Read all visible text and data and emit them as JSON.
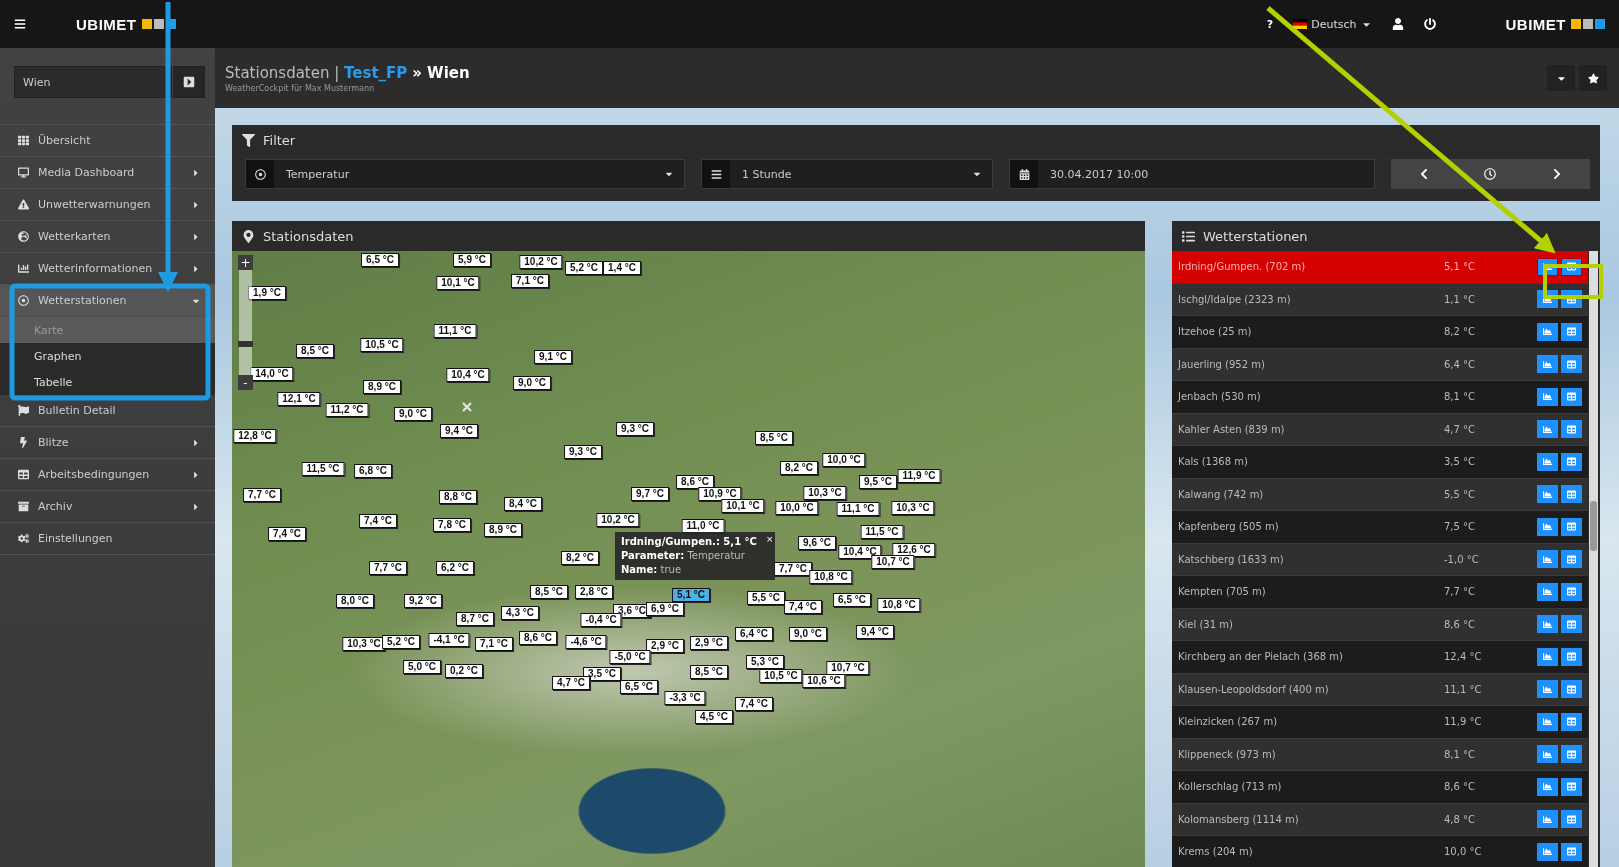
{
  "topbar": {
    "logo": "UBIMET",
    "help": "?",
    "language": "Deutsch",
    "logo_right": "UBIMET"
  },
  "sidebar": {
    "search": {
      "value": "Wien"
    },
    "items": [
      {
        "label": "Übersicht",
        "expandable": false
      },
      {
        "label": "Media Dashboard",
        "expandable": true,
        "expanded": false
      },
      {
        "label": "Unwetterwarnungen",
        "expandable": true,
        "expanded": false
      },
      {
        "label": "Wetterkarten",
        "expandable": true,
        "expanded": false
      },
      {
        "label": "Wetterinformationen",
        "expandable": true,
        "expanded": false
      },
      {
        "label": "Wetterstationen",
        "expandable": true,
        "expanded": true,
        "children": [
          {
            "label": "Karte",
            "selected": true
          },
          {
            "label": "Graphen",
            "selected": false
          },
          {
            "label": "Tabelle",
            "selected": false
          }
        ]
      },
      {
        "label": "Bulletin Detail",
        "expandable": false
      },
      {
        "label": "Blitze",
        "expandable": true,
        "expanded": false
      },
      {
        "label": "Arbeitsbedingungen",
        "expandable": true,
        "expanded": false
      },
      {
        "label": "Archiv",
        "expandable": true,
        "expanded": false
      },
      {
        "label": "Einstellungen",
        "expandable": false
      }
    ]
  },
  "page_header": {
    "title": "Stationsdaten",
    "separator": "|",
    "project": "Test_FP",
    "arrow": "»",
    "location": "Wien",
    "subtitle": "WeatherCockpit für Max Mustermann"
  },
  "filter": {
    "title": "Filter",
    "parameter": "Temperatur",
    "interval": "1 Stunde",
    "date": "30.04.2017 10:00"
  },
  "map": {
    "title": "Stationsdaten",
    "zoom_in": "+",
    "zoom_out": "-",
    "zoom_slider": {
      "level": 0.3
    },
    "markers": [
      {
        "label": "6,5 °C",
        "selected": false
      },
      {
        "label": "5,9 °C",
        "selected": false
      },
      {
        "label": "10,2 °C",
        "selected": false
      },
      {
        "label": "5,2 °C",
        "selected": false
      },
      {
        "label": "1,4 °C",
        "selected": false
      },
      {
        "label": "10,1 °C",
        "selected": false
      },
      {
        "label": "7,1 °C",
        "selected": false
      },
      {
        "label": "1,9 °C",
        "selected": false
      },
      {
        "label": "11,1 °C",
        "selected": false
      },
      {
        "label": "8,5 °C",
        "selected": false
      },
      {
        "label": "10,5 °C",
        "selected": false
      },
      {
        "label": "9,1 °C",
        "selected": false
      },
      {
        "label": "14,0 °C",
        "selected": false
      },
      {
        "label": "10,4 °C",
        "selected": false
      },
      {
        "label": "9,0 °C",
        "selected": false
      },
      {
        "label": "8,9 °C",
        "selected": false
      },
      {
        "label": "12,1 °C",
        "selected": false
      },
      {
        "label": "11,2 °C",
        "selected": false
      },
      {
        "label": "9,0 °C",
        "selected": false
      },
      {
        "label": "9,4 °C",
        "selected": false
      },
      {
        "label": "9,3 °C",
        "selected": false
      },
      {
        "label": "12,8 °C",
        "selected": false
      },
      {
        "label": "9,3 °C",
        "selected": false
      },
      {
        "label": "11,5 °C",
        "selected": false
      },
      {
        "label": "6,8 °C",
        "selected": false
      },
      {
        "label": "7,7 °C",
        "selected": false
      },
      {
        "label": "8,8 °C",
        "selected": false
      },
      {
        "label": "8,4 °C",
        "selected": false
      },
      {
        "label": "9,7 °C",
        "selected": false
      },
      {
        "label": "8,6 °C",
        "selected": false
      },
      {
        "label": "7,4 °C",
        "selected": false
      },
      {
        "label": "7,8 °C",
        "selected": false
      },
      {
        "label": "8,9 °C",
        "selected": false
      },
      {
        "label": "10,2 °C",
        "selected": false
      },
      {
        "label": "7,4 °C",
        "selected": false
      },
      {
        "label": "8,5 °C",
        "selected": false
      },
      {
        "label": "10,0 °C",
        "selected": false
      },
      {
        "label": "8,2 °C",
        "selected": false
      },
      {
        "label": "11,9 °C",
        "selected": false
      },
      {
        "label": "9,5 °C",
        "selected": false
      },
      {
        "label": "10,9 °C",
        "selected": false
      },
      {
        "label": "10,3 °C",
        "selected": false
      },
      {
        "label": "10,1 °C",
        "selected": false
      },
      {
        "label": "10,0 °C",
        "selected": false
      },
      {
        "label": "11,1 °C",
        "selected": false
      },
      {
        "label": "10,3 °C",
        "selected": false
      },
      {
        "label": "11,0 °C",
        "selected": false
      },
      {
        "label": "11,5 °C",
        "selected": false
      },
      {
        "label": "9,6 °C",
        "selected": false
      },
      {
        "label": "10,4 °C",
        "selected": false
      },
      {
        "label": "12,6 °C",
        "selected": false
      },
      {
        "label": "10,7 °C",
        "selected": false
      },
      {
        "label": "7,7 °C",
        "selected": false
      },
      {
        "label": "6,2 °C",
        "selected": false
      },
      {
        "label": "8,2 °C",
        "selected": false
      },
      {
        "label": "7,7 °C",
        "selected": false
      },
      {
        "label": "10,8 °C",
        "selected": false
      },
      {
        "label": "8,0 °C",
        "selected": false
      },
      {
        "label": "9,2 °C",
        "selected": false
      },
      {
        "label": "8,5 °C",
        "selected": false
      },
      {
        "label": "2,8 °C",
        "selected": false
      },
      {
        "label": "5,1 °C",
        "selected": true
      },
      {
        "label": "5,5 °C",
        "selected": false
      },
      {
        "label": "7,4 °C",
        "selected": false
      },
      {
        "label": "6,5 °C",
        "selected": false
      },
      {
        "label": "10,8 °C",
        "selected": false
      },
      {
        "label": "8,7 °C",
        "selected": false
      },
      {
        "label": "4,3 °C",
        "selected": false
      },
      {
        "label": "3,6 °C",
        "selected": false
      },
      {
        "label": "6,9 °C",
        "selected": false
      },
      {
        "label": "-0,4 °C",
        "selected": false
      },
      {
        "label": "10,3 °C",
        "selected": false
      },
      {
        "label": "5,2 °C",
        "selected": false
      },
      {
        "label": "-4,1 °C",
        "selected": false
      },
      {
        "label": "7,1 °C",
        "selected": false
      },
      {
        "label": "8,6 °C",
        "selected": false
      },
      {
        "label": "-4,6 °C",
        "selected": false
      },
      {
        "label": "6,4 °C",
        "selected": false
      },
      {
        "label": "9,0 °C",
        "selected": false
      },
      {
        "label": "9,4 °C",
        "selected": false
      },
      {
        "label": "2,9 °C",
        "selected": false
      },
      {
        "label": "2,9 °C",
        "selected": false
      },
      {
        "label": "-5,0 °C",
        "selected": false
      },
      {
        "label": "5,0 °C",
        "selected": false
      },
      {
        "label": "0,2 °C",
        "selected": false
      },
      {
        "label": "5,3 °C",
        "selected": false
      },
      {
        "label": "10,7 °C",
        "selected": false
      },
      {
        "label": "8,5 °C",
        "selected": false
      },
      {
        "label": "10,5 °C",
        "selected": false
      },
      {
        "label": "10,6 °C",
        "selected": false
      },
      {
        "label": "3,5 °C",
        "selected": false
      },
      {
        "label": "4,7 °C",
        "selected": false
      },
      {
        "label": "6,5 °C",
        "selected": false
      },
      {
        "label": "-3,3 °C",
        "selected": false
      },
      {
        "label": "7,4 °C",
        "selected": false
      },
      {
        "label": "4,5 °C",
        "selected": false
      }
    ],
    "popup": {
      "title": "Irdning/Gumpen.: 5,1 °C",
      "close": "×",
      "lines": [
        {
          "key": "Parameter:",
          "value": "Temperatur"
        },
        {
          "key": "Name:",
          "value": "true"
        }
      ]
    }
  },
  "stations": {
    "title": "Wetterstationen",
    "rows": [
      {
        "name": "Irdning/Gumpen. (702 m)",
        "value": "5,1 °C",
        "selected": true
      },
      {
        "name": "Ischgl/Idalpe (2323 m)",
        "value": "1,1 °C",
        "selected": false
      },
      {
        "name": "Itzehoe (25 m)",
        "value": "8,2 °C",
        "selected": false
      },
      {
        "name": "Jauerling (952 m)",
        "value": "6,4 °C",
        "selected": false
      },
      {
        "name": "Jenbach (530 m)",
        "value": "8,1 °C",
        "selected": false
      },
      {
        "name": "Kahler Asten (839 m)",
        "value": "4,7 °C",
        "selected": false
      },
      {
        "name": "Kals (1368 m)",
        "value": "3,5 °C",
        "selected": false
      },
      {
        "name": "Kalwang (742 m)",
        "value": "5,5 °C",
        "selected": false
      },
      {
        "name": "Kapfenberg (505 m)",
        "value": "7,5 °C",
        "selected": false
      },
      {
        "name": "Katschberg (1633 m)",
        "value": "-1,0 °C",
        "selected": false
      },
      {
        "name": "Kempten (705 m)",
        "value": "7,7 °C",
        "selected": false
      },
      {
        "name": "Kiel (31 m)",
        "value": "8,6 °C",
        "selected": false
      },
      {
        "name": "Kirchberg an der Pielach (368 m)",
        "value": "12,4 °C",
        "selected": false
      },
      {
        "name": "Klausen-Leopoldsdorf (400 m)",
        "value": "11,1 °C",
        "selected": false
      },
      {
        "name": "Kleinzicken (267 m)",
        "value": "11,9 °C",
        "selected": false
      },
      {
        "name": "Klippeneck (973 m)",
        "value": "8,1 °C",
        "selected": false
      },
      {
        "name": "Kollerschlag (713 m)",
        "value": "8,6 °C",
        "selected": false
      },
      {
        "name": "Kolomansberg (1114 m)",
        "value": "4,8 °C",
        "selected": false
      },
      {
        "name": "Krems (204 m)",
        "value": "10,0 °C",
        "selected": false
      }
    ]
  }
}
